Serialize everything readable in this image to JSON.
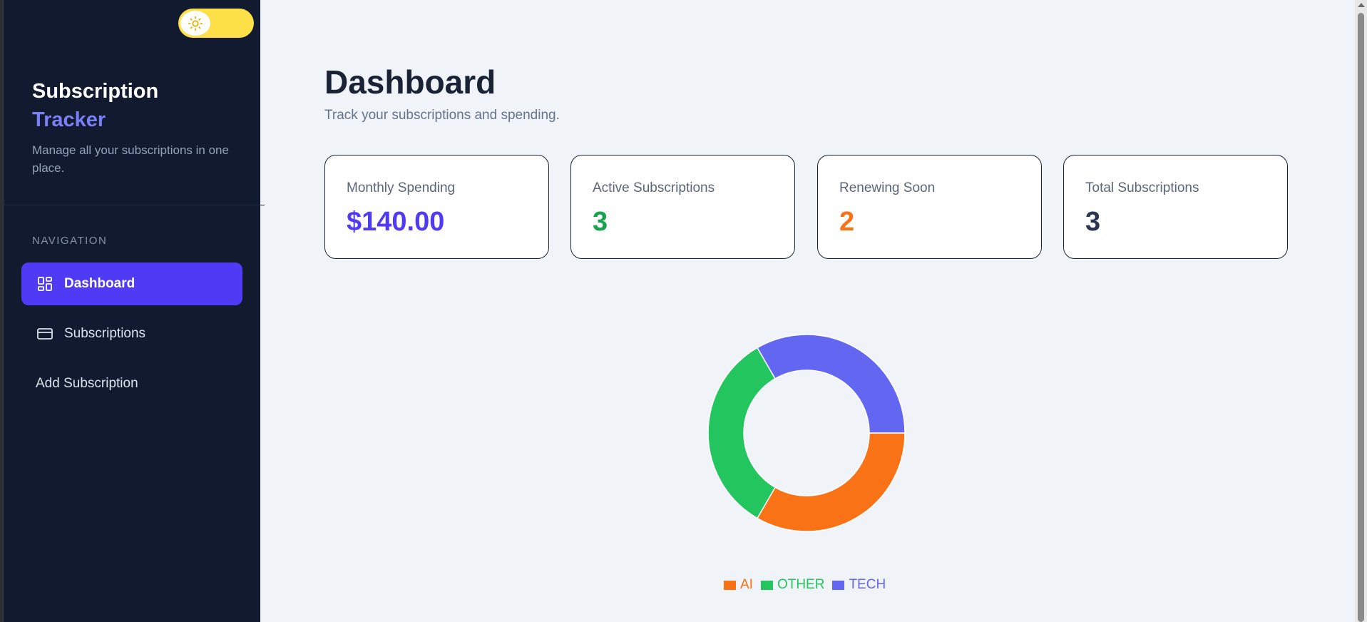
{
  "sidebar": {
    "brand_title": "Subscription",
    "brand_highlight": "Tracker",
    "brand_subtitle": "Manage all your subscriptions in one place.",
    "nav_heading": "NAVIGATION",
    "items": [
      {
        "label": "Dashboard",
        "icon": "dashboard-grid-icon",
        "active": true
      },
      {
        "label": "Subscriptions",
        "icon": "credit-card-icon",
        "active": false
      },
      {
        "label": "Add Subscription",
        "icon": "",
        "active": false
      }
    ],
    "theme_toggle": {
      "icon": "sun-icon",
      "state": "light"
    }
  },
  "main": {
    "title": "Dashboard",
    "subtitle": "Track your subscriptions and spending.",
    "stats": [
      {
        "label": "Monthly Spending",
        "value": "$140.00",
        "color": "#4f3bf5"
      },
      {
        "label": "Active Subscriptions",
        "value": "3",
        "color": "#16a34a"
      },
      {
        "label": "Renewing Soon",
        "value": "2",
        "color": "#f97316"
      },
      {
        "label": "Total Subscriptions",
        "value": "3",
        "color": "#2b3550"
      }
    ]
  },
  "chart_data": {
    "type": "pie",
    "categories": [
      "AI",
      "OTHER",
      "TECH"
    ],
    "values": [
      1,
      1,
      1
    ],
    "colors": [
      "#f97316",
      "#22c55e",
      "#6366f1"
    ],
    "donut": true,
    "legend_position": "bottom"
  }
}
